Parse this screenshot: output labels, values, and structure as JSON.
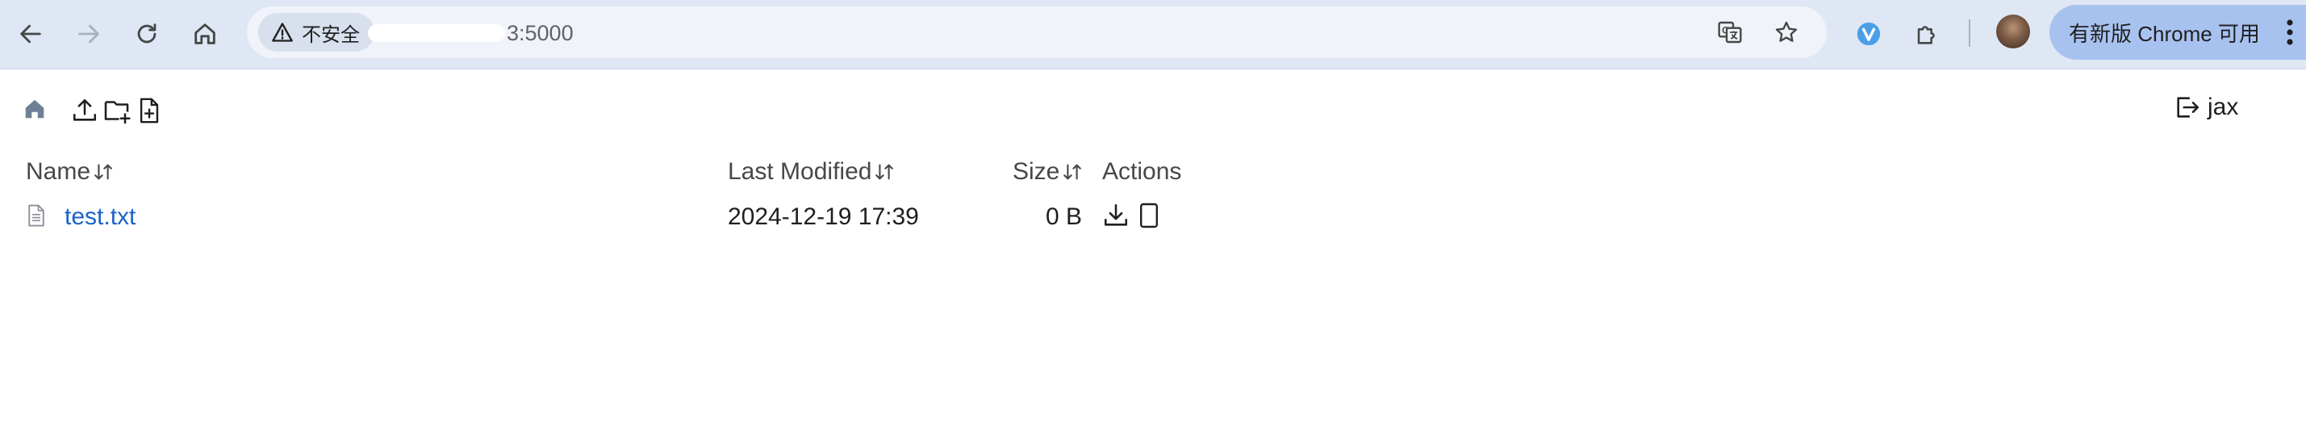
{
  "browser": {
    "security_label": "不安全",
    "url": "3:5000",
    "update_label": "有新版 Chrome 可用"
  },
  "page": {
    "user": "jax",
    "columns": {
      "name": "Name",
      "modified": "Last Modified",
      "size": "Size",
      "actions": "Actions"
    },
    "files": [
      {
        "name": "test.txt",
        "modified": "2024-12-19 17:39",
        "size": "0 B"
      }
    ]
  },
  "colors": {
    "link": "#1a63c6",
    "toolbar": "#dfe7f5",
    "accent_pill": "#a8c2f0"
  },
  "icons": [
    "back-icon",
    "forward-icon",
    "reload-icon",
    "home-icon",
    "warning-icon",
    "translate-icon",
    "star-icon",
    "extension-v-icon",
    "puzzle-icon",
    "more-icon",
    "folder-home-icon",
    "upload-icon",
    "new-folder-icon",
    "new-file-icon",
    "logout-icon",
    "sort-icon",
    "file-icon",
    "download-icon",
    "view-icon"
  ]
}
